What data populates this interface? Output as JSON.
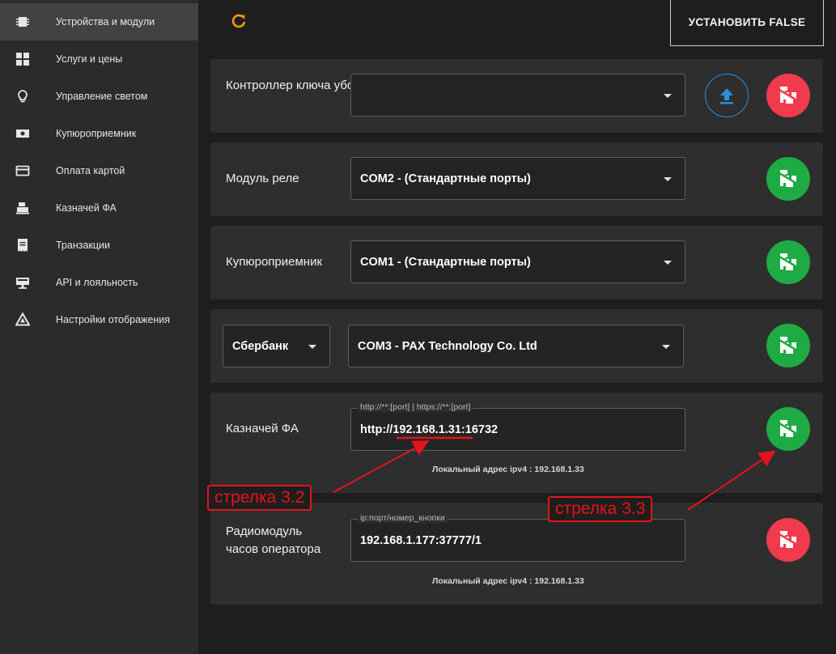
{
  "sidebar": {
    "items": [
      {
        "label": "Устройства и модули",
        "icon": "devices-icon",
        "active": true
      },
      {
        "label": "Услуги и цены",
        "icon": "grid-icon",
        "active": false
      },
      {
        "label": "Управление светом",
        "icon": "lightbulb-icon",
        "active": false
      },
      {
        "label": "Купюроприемник",
        "icon": "cash-icon",
        "active": false
      },
      {
        "label": "Оплата картой",
        "icon": "credit-card-icon",
        "active": false
      },
      {
        "label": "Казначей ФА",
        "icon": "cash-register-icon",
        "active": false
      },
      {
        "label": "Транзакции",
        "icon": "receipt-icon",
        "active": false
      },
      {
        "label": "API и лояльность",
        "icon": "api-icon",
        "active": false
      },
      {
        "label": "Настройки отображения",
        "icon": "display-settings-icon",
        "active": false
      }
    ]
  },
  "header": {
    "refresh_icon": "refresh-icon",
    "set_button": "УСТАНОВИТЬ FALSE"
  },
  "cards": {
    "key_controller": {
      "label": "Контроллер ключа уборки",
      "select_value": "",
      "status": "disconnected"
    },
    "relay": {
      "label": "Модуль реле",
      "select_value": "COM2 - (Стандартные порты)",
      "status": "connected"
    },
    "bill_acceptor": {
      "label": "Купюроприемник",
      "select_value": "COM1 - (Стандартные порты)",
      "status": "connected"
    },
    "bank": {
      "provider": "Сбербанк",
      "select_value": "COM3 - PAX Technology Co. Ltd",
      "status": "connected"
    },
    "fiscal": {
      "label": "Казначей ФА",
      "field_legend": "http://**:[port] | https://**:[port]",
      "field_value": "http://192.168.1.31:16732",
      "hint": "Локальный адрес ipv4 : 192.168.1.33",
      "status": "connected"
    },
    "radio": {
      "label": "Радиомодуль часов оператора",
      "field_legend": "ip:порт/номер_кнопки",
      "field_value": "192.168.1.177:37777/1",
      "hint": "Локальный адрес ipv4 : 192.168.1.33",
      "status": "disconnected"
    }
  },
  "annotations": {
    "arrow_32": "стрелка  3.2",
    "arrow_33": "стрелка  3.3"
  },
  "colors": {
    "accent_orange": "#f39c12",
    "connected_green": "#1fab43",
    "disconnected_red": "#f03b4c",
    "upload_blue": "#2b8fe0",
    "annotation_red": "#e3141c"
  }
}
